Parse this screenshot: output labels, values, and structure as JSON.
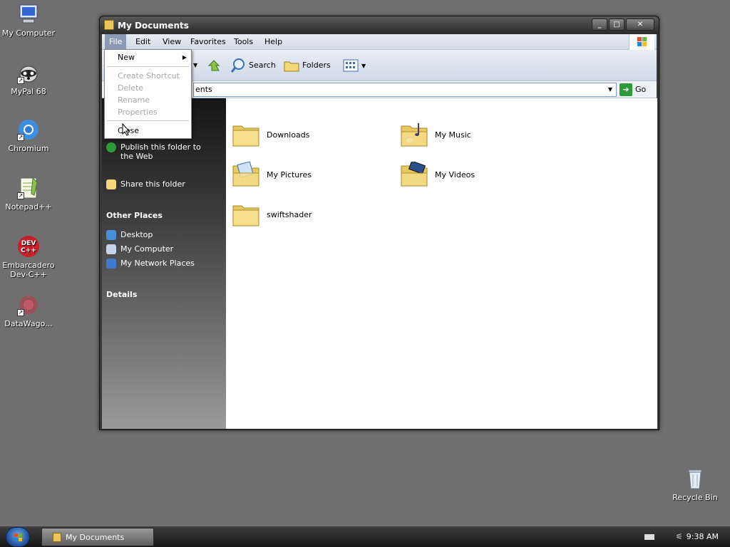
{
  "desktop": {
    "icons": [
      {
        "label": "My Computer",
        "icon": "my-computer-icon"
      },
      {
        "label": "MyPal 68",
        "icon": "mypal-icon"
      },
      {
        "label": "Chromium",
        "icon": "chromium-icon"
      },
      {
        "label": "Notepad++",
        "icon": "notepadpp-icon"
      },
      {
        "label": "Embarcadero Dev-C++",
        "icon": "devcpp-icon"
      },
      {
        "label": "DataWago...",
        "icon": "datawagon-icon"
      },
      {
        "label": "Recycle Bin",
        "icon": "recycle-bin-icon"
      }
    ]
  },
  "window": {
    "title": "My Documents",
    "controls": {
      "minimize": "_",
      "maximize": "□",
      "close": "✕"
    }
  },
  "menubar": {
    "items": [
      "File",
      "Edit",
      "View",
      "Favorites",
      "Tools",
      "Help"
    ]
  },
  "toolbar": {
    "search": "Search",
    "folders": "Folders"
  },
  "addressbar": {
    "value_visible": "ents",
    "go": "Go"
  },
  "file_menu": {
    "items": [
      {
        "label": "New",
        "enabled": true
      },
      {
        "label": "Create Shortcut",
        "enabled": false
      },
      {
        "label": "Delete",
        "enabled": false
      },
      {
        "label": "Rename",
        "enabled": false
      },
      {
        "label": "Properties",
        "enabled": false
      },
      {
        "label": "Close",
        "enabled": true
      }
    ]
  },
  "tasks": {
    "publish": "Publish this folder to the Web",
    "share": "Share this folder"
  },
  "other_places": {
    "heading": "Other Places",
    "items": [
      "Desktop",
      "My Computer",
      "My Network Places"
    ]
  },
  "details": {
    "heading": "Details"
  },
  "folders": [
    {
      "name": "Downloads"
    },
    {
      "name": "My Music"
    },
    {
      "name": "My Pictures"
    },
    {
      "name": "My Videos"
    },
    {
      "name": "swiftshader"
    }
  ],
  "taskbar": {
    "task_title": "My Documents",
    "clock": "9:38 AM"
  },
  "colors": {
    "desktop": "#6f6f6f",
    "menu_highlight": "#8b9bb5",
    "go_green": "#2e9a3a",
    "folder_yellow": "#f3d77a"
  }
}
